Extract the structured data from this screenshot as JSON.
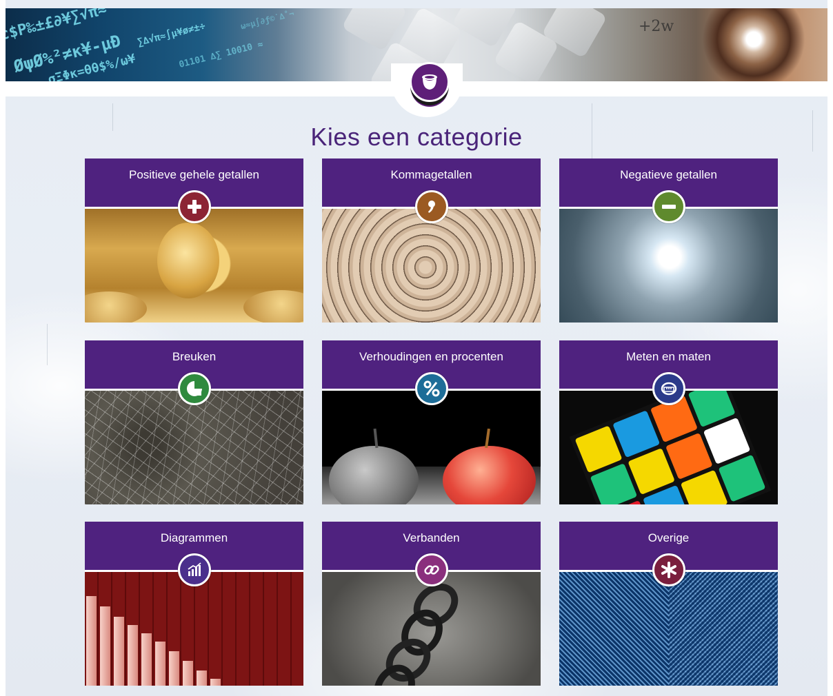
{
  "page": {
    "title": "Kies een categorie"
  },
  "banner": {
    "logo_icon": "pot-logo-icon",
    "formula_text": "+2w"
  },
  "categories": [
    {
      "label": "Positieve gehele getallen",
      "icon": "plus-icon",
      "color": "#8c2434",
      "image": "gold-coins"
    },
    {
      "label": "Kommagetallen",
      "icon": "comma-icon",
      "color": "#9b5a22",
      "image": "number-spiral"
    },
    {
      "label": "Negatieve getallen",
      "icon": "minus-icon",
      "color": "#5f8a2d",
      "image": "number-tunnel"
    },
    {
      "label": "Breuken",
      "icon": "fraction-pie-icon",
      "color": "#2f8a3e",
      "image": "cracked-glass"
    },
    {
      "label": "Verhoudingen en procenten",
      "icon": "percent-icon",
      "color": "#1d6d98",
      "image": "apples"
    },
    {
      "label": "Meten en maten",
      "icon": "measuring-tape-icon",
      "color": "#2b3a8a",
      "image": "rubiks-cube"
    },
    {
      "label": "Diagrammen",
      "icon": "bar-chart-icon",
      "color": "#4b2f8c",
      "image": "red-bar-chart"
    },
    {
      "label": "Verbanden",
      "icon": "link-icon",
      "color": "#8a2f7d",
      "image": "chain"
    },
    {
      "label": "Overige",
      "icon": "asterisk-icon",
      "color": "#7a1f3d",
      "image": "blue-lines"
    }
  ]
}
